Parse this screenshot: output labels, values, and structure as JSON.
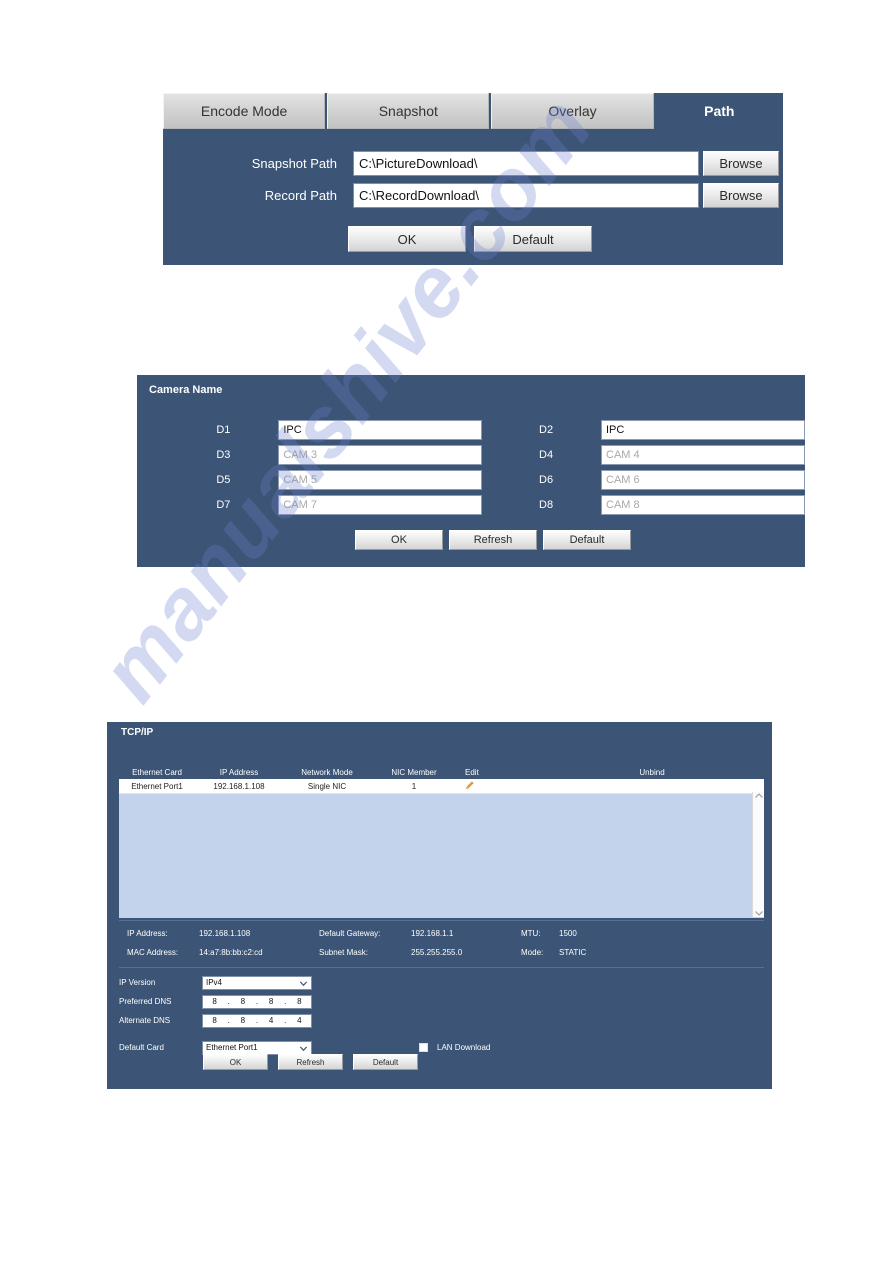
{
  "watermark": {
    "text": "manualshive.com"
  },
  "path_panel": {
    "tabs": [
      {
        "label": "Encode Mode",
        "active": false
      },
      {
        "label": "Snapshot",
        "active": false
      },
      {
        "label": "Overlay",
        "active": false
      },
      {
        "label": "Path",
        "active": true
      }
    ],
    "fields": [
      {
        "label": "Snapshot Path",
        "value": "C:\\PictureDownload\\",
        "button": "Browse"
      },
      {
        "label": "Record Path",
        "value": "C:\\RecordDownload\\",
        "button": "Browse"
      }
    ],
    "buttons": {
      "ok": "OK",
      "default": "Default"
    }
  },
  "camera_panel": {
    "title": "Camera Name",
    "channels": [
      {
        "label": "D1",
        "value": "IPC",
        "placeholder": false
      },
      {
        "label": "D2",
        "value": "IPC",
        "placeholder": false
      },
      {
        "label": "D3",
        "value": "CAM 3",
        "placeholder": true
      },
      {
        "label": "D4",
        "value": "CAM 4",
        "placeholder": true
      },
      {
        "label": "D5",
        "value": "CAM 5",
        "placeholder": true
      },
      {
        "label": "D6",
        "value": "CAM 6",
        "placeholder": true
      },
      {
        "label": "D7",
        "value": "CAM 7",
        "placeholder": true
      },
      {
        "label": "D8",
        "value": "CAM 8",
        "placeholder": true
      }
    ],
    "buttons": {
      "ok": "OK",
      "refresh": "Refresh",
      "default": "Default"
    }
  },
  "tcpip_panel": {
    "title": "TCP/IP",
    "table": {
      "headers": [
        "Ethernet Card",
        "IP Address",
        "Network Mode",
        "NIC Member",
        "Edit",
        "Unbind"
      ],
      "rows": [
        {
          "ethernet_card": "Ethernet Port1",
          "ip_address": "192.168.1.108",
          "network_mode": "Single NIC",
          "nic_member": "1",
          "edit_icon": "pencil-icon",
          "unbind": ""
        }
      ]
    },
    "info": {
      "ip_address_label": "IP Address:",
      "ip_address_value": "192.168.1.108",
      "mac_address_label": "MAC Address:",
      "mac_address_value": "14:a7:8b:bb:c2:cd",
      "gateway_label": "Default Gateway:",
      "gateway_value": "192.168.1.1",
      "subnet_label": "Subnet Mask:",
      "subnet_value": "255.255.255.0",
      "mtu_label": "MTU:",
      "mtu_value": "1500",
      "mode_label": "Mode:",
      "mode_value": "STATIC"
    },
    "form": {
      "ip_version_label": "IP Version",
      "ip_version_value": "IPv4",
      "preferred_dns_label": "Preferred DNS",
      "preferred_dns": [
        "8",
        "8",
        "8",
        "8"
      ],
      "alternate_dns_label": "Alternate DNS",
      "alternate_dns": [
        "8",
        "8",
        "4",
        "4"
      ],
      "default_card_label": "Default Card",
      "default_card_value": "Ethernet Port1",
      "lan_download_label": "LAN Download",
      "lan_download_checked": false
    },
    "buttons": {
      "ok": "OK",
      "refresh": "Refresh",
      "default": "Default"
    }
  },
  "colors": {
    "panel_bg": "#3c5475",
    "table_body": "#c3d3ec",
    "edit_icon": "#f0a030",
    "accent_text": "#ffffff"
  }
}
